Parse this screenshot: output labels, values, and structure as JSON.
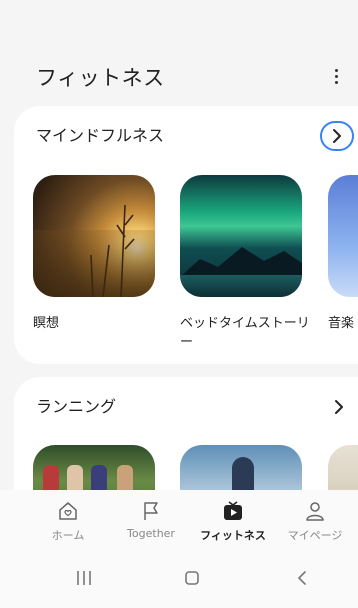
{
  "header": {
    "title": "フィットネス",
    "more_icon": "more-vert-icon"
  },
  "sections": [
    {
      "title": "マインドフルネス",
      "chevron_icon": "chevron-right-icon",
      "items": [
        {
          "label": "瞑想"
        },
        {
          "label": "ベッドタイムストーリー"
        },
        {
          "label": "音楽"
        }
      ]
    },
    {
      "title": "ランニング",
      "chevron_icon": "chevron-right-icon"
    }
  ],
  "bottom_nav": [
    {
      "label": "ホーム",
      "icon": "home-heart-icon",
      "active": false
    },
    {
      "label": "Together",
      "icon": "flag-icon",
      "active": false
    },
    {
      "label": "フィットネス",
      "icon": "play-tv-icon",
      "active": true
    },
    {
      "label": "マイページ",
      "icon": "person-icon",
      "active": false
    }
  ],
  "system_nav": {
    "recents": "recents-icon",
    "home": "home-button-icon",
    "back": "back-icon"
  },
  "colors": {
    "accent": "#3b82f6",
    "background": "#f5f5f5",
    "card": "#ffffff"
  }
}
